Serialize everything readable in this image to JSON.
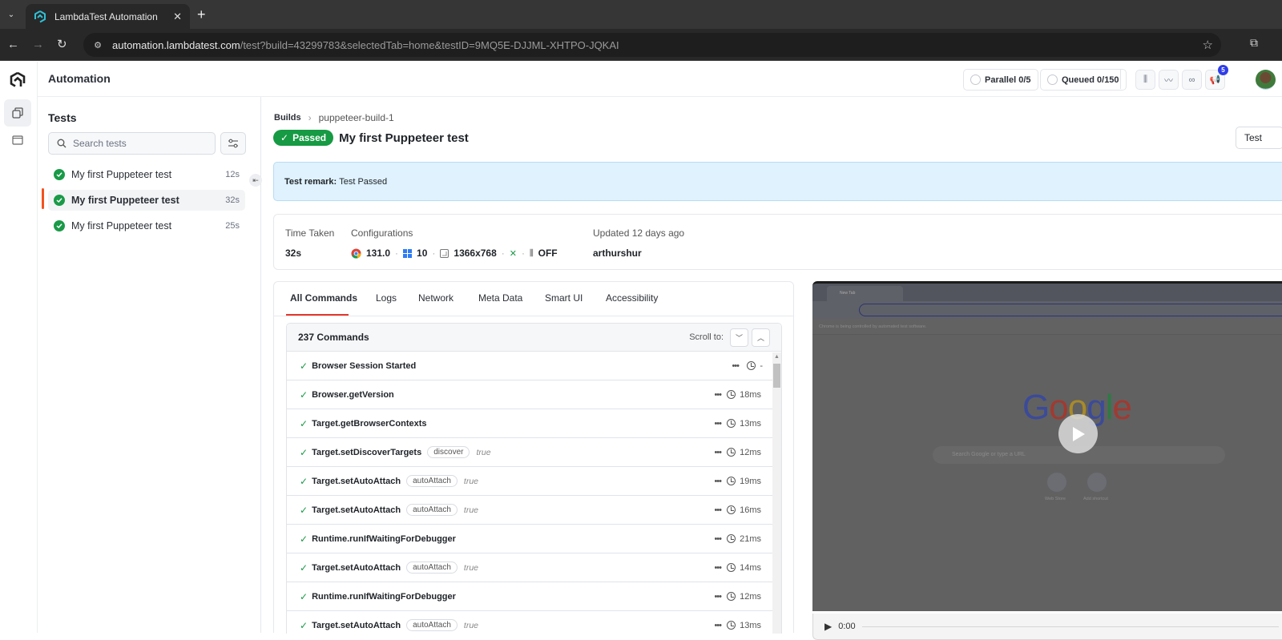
{
  "browser": {
    "tab_title": "LambdaTest Automation",
    "url_host": "automation.lambdatest.com",
    "url_path": "/test?build=43299783&selectedTab=home&testID=9MQ5E-DJJML-XHTPO-JQKAI"
  },
  "topbar": {
    "title": "Automation",
    "parallel_label": "Parallel",
    "parallel_value": "0/5",
    "queued_label": "Queued",
    "queued_value": "0/150",
    "notification_count": "5"
  },
  "tests_panel": {
    "title": "Tests",
    "search_placeholder": "Search tests",
    "items": [
      {
        "name": "My first Puppeteer test",
        "duration": "12s",
        "status": "passed",
        "selected": false
      },
      {
        "name": "My first Puppeteer test",
        "duration": "32s",
        "status": "passed",
        "selected": true
      },
      {
        "name": "My first Puppeteer test",
        "duration": "25s",
        "status": "passed",
        "selected": false
      }
    ]
  },
  "main": {
    "breadcrumb": {
      "root": "Builds",
      "current": "puppeteer-build-1"
    },
    "status_label": "Passed",
    "test_title": "My first Puppeteer test",
    "top_right_button": "Test",
    "remark_label": "Test remark:",
    "remark_text": "Test Passed",
    "info": {
      "time_taken_label": "Time Taken",
      "time_taken_value": "32s",
      "config_label": "Configurations",
      "browser_version": "131.0",
      "os_version": "10",
      "resolution": "1366x768",
      "tunnel_status": "OFF",
      "updated_label": "Updated 12 days ago",
      "user": "arthurshur"
    },
    "tabs": [
      "All Commands",
      "Logs",
      "Network",
      "Meta Data",
      "Smart UI",
      "Accessibility"
    ],
    "active_tab": "All Commands",
    "commands_count": "237 Commands",
    "scroll_to_label": "Scroll to:",
    "commands": [
      {
        "name": "Browser Session Started",
        "param": "",
        "value": "",
        "time": "-"
      },
      {
        "name": "Browser.getVersion",
        "param": "",
        "value": "",
        "time": "18ms"
      },
      {
        "name": "Target.getBrowserContexts",
        "param": "",
        "value": "",
        "time": "13ms"
      },
      {
        "name": "Target.setDiscoverTargets",
        "param": "discover",
        "value": "true",
        "time": "12ms"
      },
      {
        "name": "Target.setAutoAttach",
        "param": "autoAttach",
        "value": "true",
        "time": "19ms"
      },
      {
        "name": "Target.setAutoAttach",
        "param": "autoAttach",
        "value": "true",
        "time": "16ms"
      },
      {
        "name": "Runtime.runIfWaitingForDebugger",
        "param": "",
        "value": "",
        "time": "21ms"
      },
      {
        "name": "Target.setAutoAttach",
        "param": "autoAttach",
        "value": "true",
        "time": "14ms"
      },
      {
        "name": "Runtime.runIfWaitingForDebugger",
        "param": "",
        "value": "",
        "time": "12ms"
      },
      {
        "name": "Target.setAutoAttach",
        "param": "autoAttach",
        "value": "true",
        "time": "13ms"
      }
    ]
  },
  "video": {
    "inner_tab_title": "New Tab",
    "inner_banner": "Chrome is being controlled by automated test software.",
    "google_search_placeholder": "Search Google or type a URL",
    "shortcut_1": "Web Store",
    "shortcut_2": "Add shortcut",
    "current_time": "0:00"
  },
  "colors": {
    "passed_green": "#169a43",
    "active_tab_red": "#e5372b",
    "selected_marker": "#f4511e",
    "remark_bg": "#dff2fd",
    "badge_blue": "#2f3ee8"
  }
}
